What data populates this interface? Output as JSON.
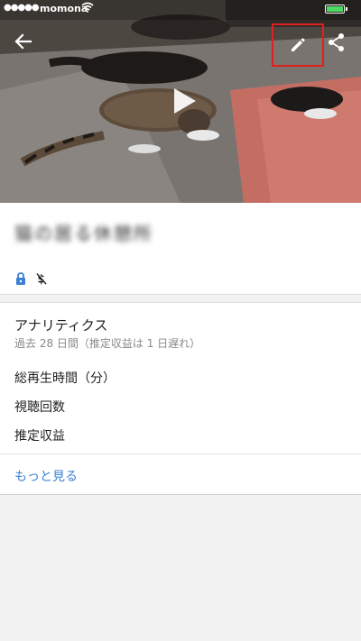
{
  "status_bar": {
    "signal": "●●●●●",
    "carrier": "momona"
  },
  "video": {
    "title": "猫の居る休憩所",
    "privacy_icon": "lock-icon",
    "monetization_icon": "monetization-off-icon"
  },
  "toolbar": {
    "back_icon": "arrow-back-icon",
    "edit_icon": "pencil-icon",
    "share_icon": "share-icon"
  },
  "analytics": {
    "heading": "アナリティクス",
    "subheading": "過去 28 日間（推定収益は 1 日遅れ）",
    "metrics": [
      {
        "label": "総再生時間（分）"
      },
      {
        "label": "視聴回数"
      },
      {
        "label": "推定収益"
      }
    ],
    "more_label": "もっと見る"
  },
  "colors": {
    "accent_link": "#3b82d6",
    "lock_icon": "#3b82d6",
    "edit_highlight": "#e0201e"
  }
}
